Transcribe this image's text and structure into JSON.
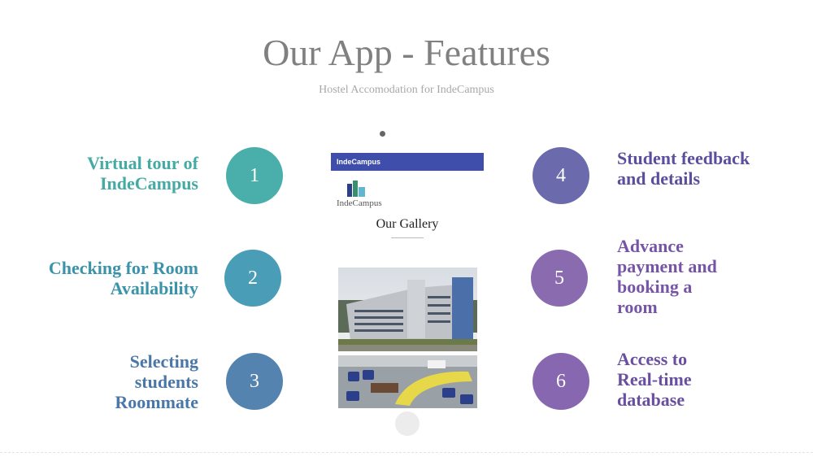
{
  "slide": {
    "title": "Our App - Features",
    "subtitle": "Hostel Accomodation for IndeCampus"
  },
  "features_left": [
    {
      "number": "1",
      "lines": [
        "Virtual tour of",
        "IndeCampus"
      ],
      "color": "#45aaa3",
      "circle_color": "#4aaeaa"
    },
    {
      "number": "2",
      "lines": [
        "Checking for Room",
        "Availability"
      ],
      "color": "#3a93a8",
      "circle_color": "#4a9db6"
    },
    {
      "number": "3",
      "lines": [
        "Selecting",
        "students",
        "Roommate"
      ],
      "color": "#4a77a8",
      "circle_color": "#5583b0"
    }
  ],
  "features_right": [
    {
      "number": "4",
      "lines": [
        "Student feedback",
        "and details"
      ],
      "color": "#5a4f9e",
      "circle_color": "#6a6aad"
    },
    {
      "number": "5",
      "lines": [
        "Advance",
        "payment and",
        "booking a",
        "room"
      ],
      "color": "#7755a6",
      "circle_color": "#8a6bb0"
    },
    {
      "number": "6",
      "lines": [
        "Access to",
        "Real-time",
        "database"
      ],
      "color": "#6a4fa0",
      "circle_color": "#8768b0"
    }
  ],
  "phone": {
    "app_bar_title": "IndeCampus",
    "app_bar_color": "#3f4dab",
    "logo_text": "IndeCampus",
    "logo_icon": "indecampus-logo-icon",
    "gallery_title": "Our Gallery",
    "images": [
      "hostel-building-photo",
      "lounge-seating-photo"
    ]
  }
}
